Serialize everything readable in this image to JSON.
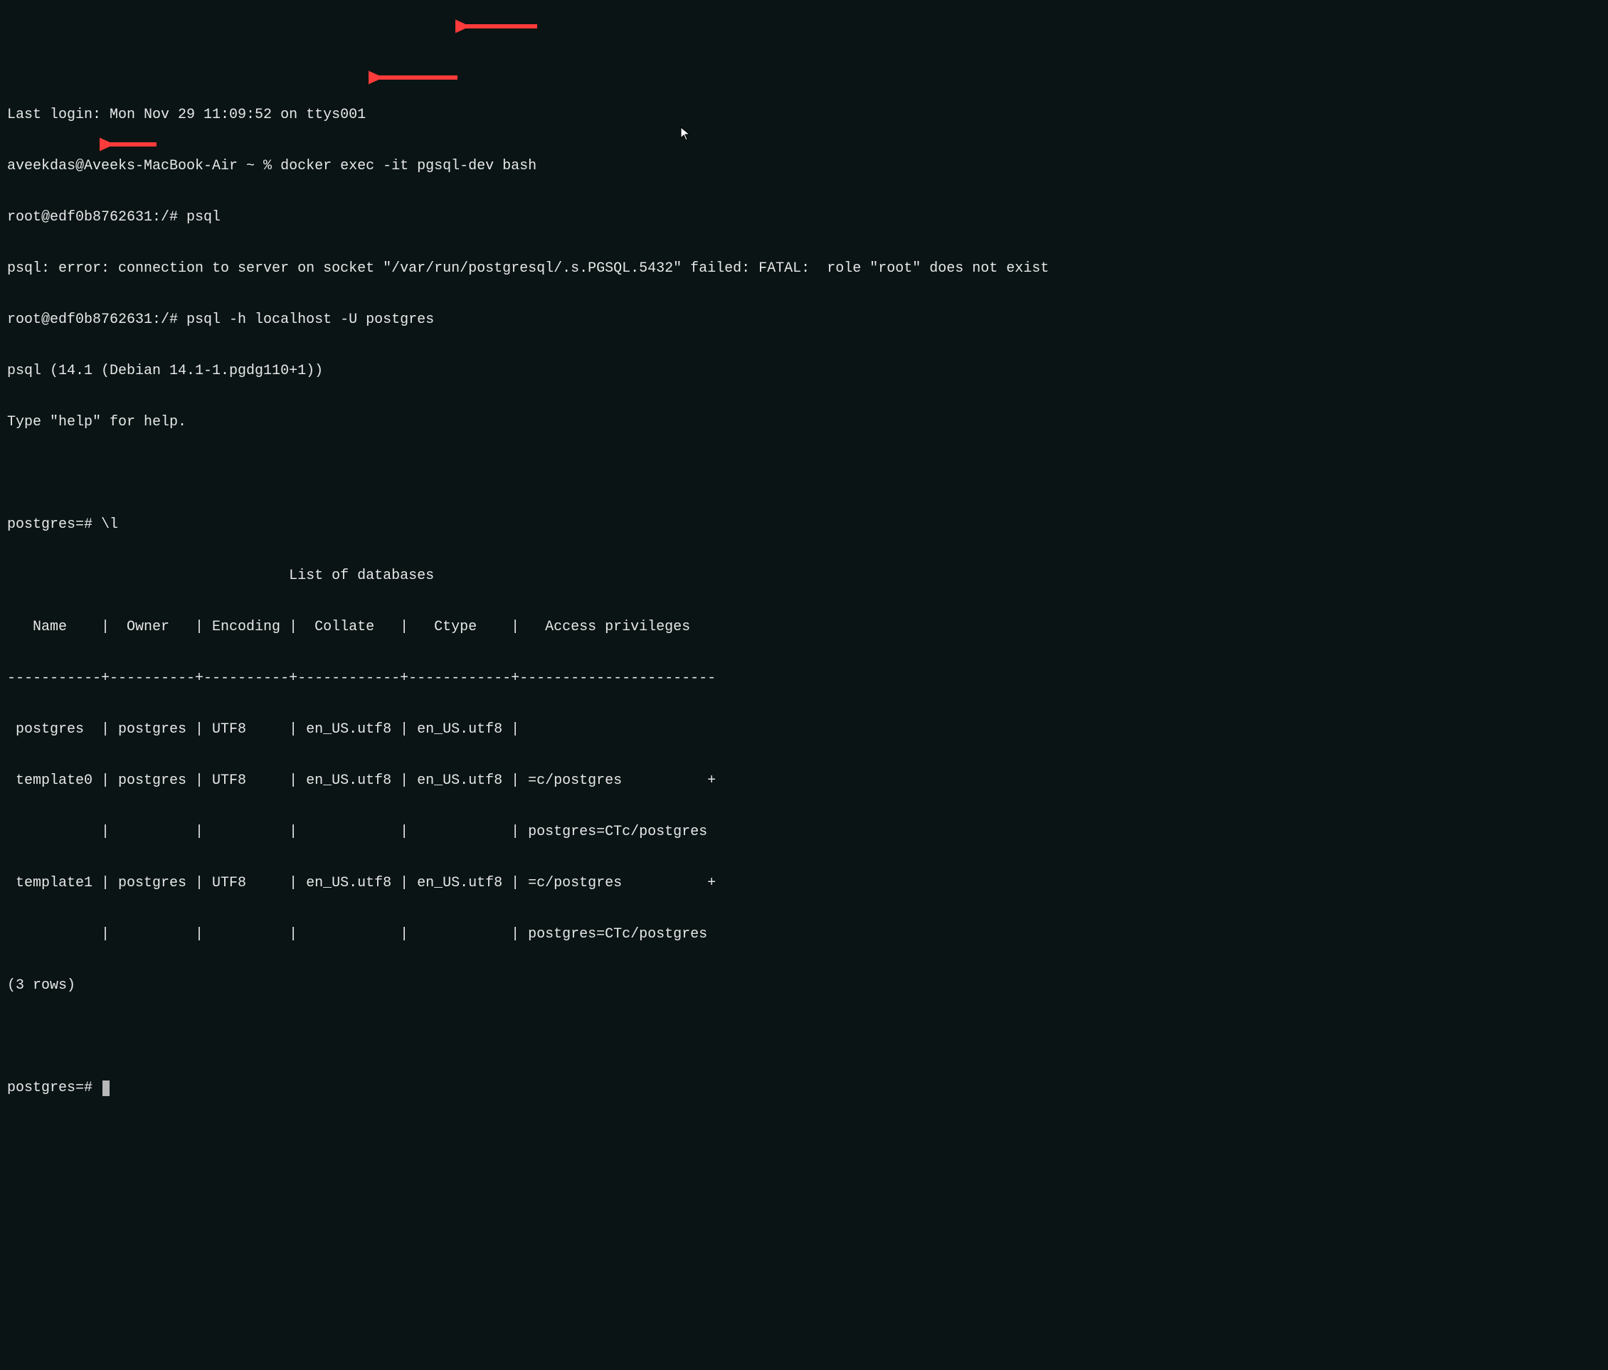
{
  "lines": {
    "login": "Last login: Mon Nov 29 11:09:52 on ttys001",
    "prompt1": "aveekdas@Aveeks-MacBook-Air ~ % docker exec -it pgsql-dev bash",
    "prompt2": "root@edf0b8762631:/# psql",
    "error": "psql: error: connection to server on socket \"/var/run/postgresql/.s.PGSQL.5432\" failed: FATAL:  role \"root\" does not exist",
    "prompt3": "root@edf0b8762631:/# psql -h localhost -U postgres",
    "version": "psql (14.1 (Debian 14.1-1.pgdg110+1))",
    "help": "Type \"help\" for help.",
    "psql1": "postgres=# \\l",
    "tabletitle": "                                 List of databases",
    "tableheader": "   Name    |  Owner   | Encoding |  Collate   |   Ctype    |   Access privileges   ",
    "tablesep": "-----------+----------+----------+------------+------------+-----------------------",
    "row1": " postgres  | postgres | UTF8     | en_US.utf8 | en_US.utf8 | ",
    "row2a": " template0 | postgres | UTF8     | en_US.utf8 | en_US.utf8 | =c/postgres          +",
    "row2b": "           |          |          |            |            | postgres=CTc/postgres",
    "row3a": " template1 | postgres | UTF8     | en_US.utf8 | en_US.utf8 | =c/postgres          +",
    "row3b": "           |          |          |            |            | postgres=CTc/postgres",
    "rowcount": "(3 rows)",
    "psql2": "postgres=# "
  }
}
